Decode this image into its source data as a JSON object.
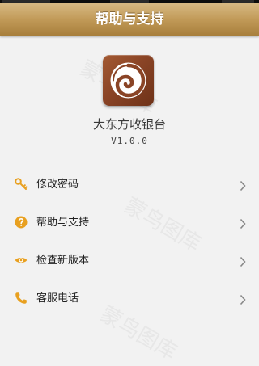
{
  "header": {
    "title": "帮助与支持"
  },
  "app": {
    "name": "大东方收银台",
    "version": "V1.0.0"
  },
  "menu": {
    "items": [
      {
        "label": "修改密码",
        "icon": "key-icon"
      },
      {
        "label": "帮助与支持",
        "icon": "question-icon"
      },
      {
        "label": "检查新版本",
        "icon": "eye-icon"
      },
      {
        "label": "客服电话",
        "icon": "phone-icon"
      }
    ]
  },
  "colors": {
    "nav_gradient_top": "#d7b983",
    "nav_gradient_bottom": "#a87f3c",
    "icon_orange": "#e8a020",
    "background": "#f2f2f2"
  }
}
